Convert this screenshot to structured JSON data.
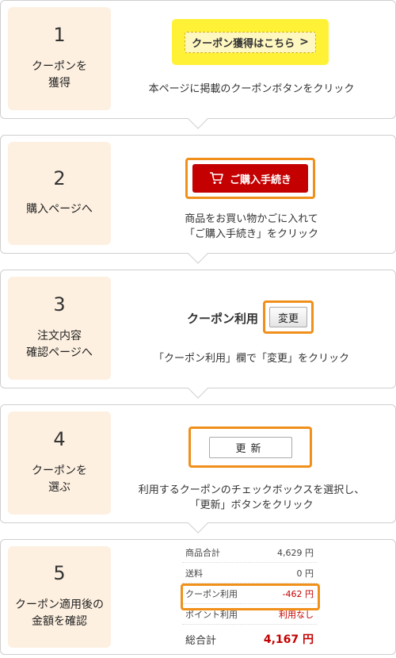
{
  "steps": [
    {
      "number": "1",
      "label": "クーポンを\n獲得",
      "banner_text": "クーポン獲得はこちら",
      "banner_arrow": ">",
      "desc": "本ページに掲載のクーポンボタンをクリック"
    },
    {
      "number": "2",
      "label": "購入ページへ",
      "button_label": "ご購入手続き",
      "button_icon": "cart-icon",
      "desc": "商品をお買い物かごに入れて\n「ご購入手続き」をクリック"
    },
    {
      "number": "3",
      "label": "注文内容\n確認ページへ",
      "coupon_use_label": "クーポン利用",
      "change_button": "変更",
      "desc": "「クーポン利用」欄で「変更」をクリック"
    },
    {
      "number": "4",
      "label": "クーポンを\n選ぶ",
      "update_button": "更新",
      "desc": "利用するクーポンのチェックボックスを選択し、\n「更新」ボタンをクリック"
    },
    {
      "number": "5",
      "label": "クーポン適用後の\n金額を確認",
      "summary": [
        {
          "label": "商品合計",
          "value": "4,629 円"
        },
        {
          "label": "送料",
          "value": "0 円"
        },
        {
          "label": "クーポン利用",
          "value": "-462 円"
        },
        {
          "label": "ポイント利用",
          "value": "利用なし"
        }
      ],
      "total_label": "総合計",
      "total_value": "4,167 円"
    }
  ],
  "colors": {
    "accent_orange": "#f0901a",
    "brand_red": "#c40000",
    "step_bg": "#fdf0e0",
    "banner_yellow": "#fff236"
  }
}
